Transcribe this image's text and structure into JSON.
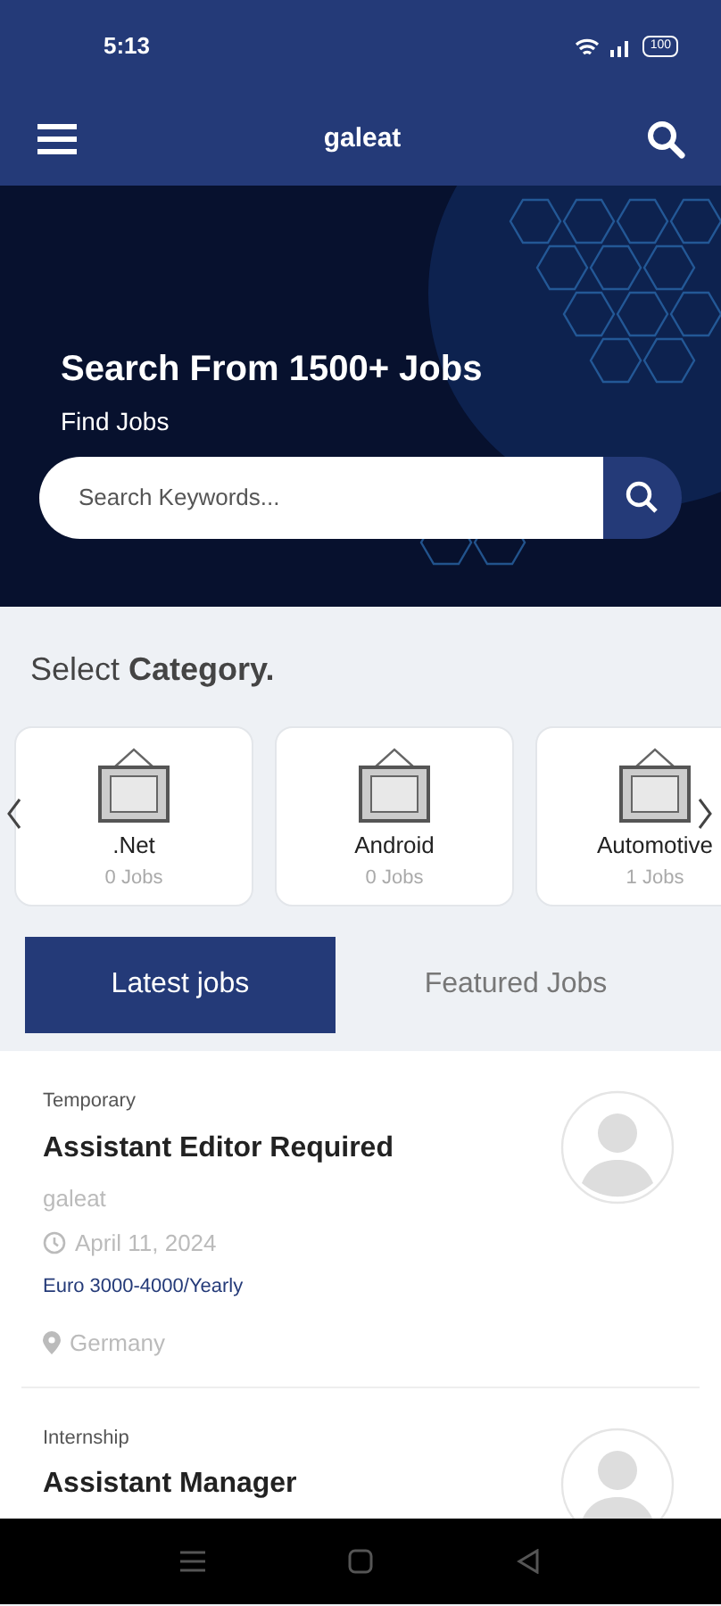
{
  "status_bar": {
    "time": "5:13",
    "battery": "100"
  },
  "app_bar": {
    "title": "galeat"
  },
  "hero": {
    "kind": "picture",
    "heading": "Search From 1500+ Jobs",
    "subheading": "Find Jobs",
    "search": {
      "placeholder": "Search Keywords..."
    }
  },
  "category_section": {
    "title": "Select **Category.**",
    "categories": [
      {
        "name": ".Net",
        "count": "0 Jobs"
      },
      {
        "name": "Android",
        "count": "0 Jobs"
      },
      {
        "name": "Automotive",
        "count": "1 Jobs"
      }
    ]
  },
  "tabs": [
    {
      "label": "Latest jobs",
      "selected": true
    },
    {
      "label": "Featured Jobs",
      "selected": false
    }
  ],
  "jobs": [
    {
      "type": "Temporary",
      "title": "Assistant Editor Required",
      "company": "galeat",
      "date": "April 11, 2024",
      "salary": "Euro 3000-4000/Yearly",
      "location": "Germany"
    },
    {
      "type": "Internship",
      "title": "Assistant Manager"
    }
  ]
}
